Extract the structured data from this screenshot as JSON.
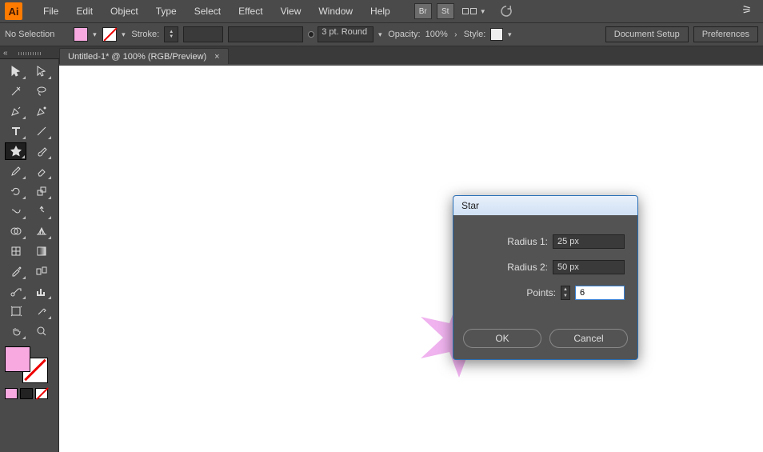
{
  "app": {
    "logo": "Ai"
  },
  "menu": {
    "items": [
      "File",
      "Edit",
      "Object",
      "Type",
      "Select",
      "Effect",
      "View",
      "Window",
      "Help"
    ],
    "br": "Br",
    "st": "St"
  },
  "control": {
    "selection": "No Selection",
    "stroke_label": "Stroke:",
    "stroke_weight": "3 pt. Round",
    "opacity_label": "Opacity:",
    "opacity_value": "100%",
    "style_label": "Style:",
    "doc_setup": "Document Setup",
    "preferences": "Preferences"
  },
  "tab": {
    "title": "Untitled-1* @ 100% (RGB/Preview)"
  },
  "dialog": {
    "title": "Star",
    "radius1_label": "Radius 1:",
    "radius1_value": "25 px",
    "radius2_label": "Radius 2:",
    "radius2_value": "50 px",
    "points_label": "Points:",
    "points_value": "6",
    "ok": "OK",
    "cancel": "Cancel"
  },
  "colors": {
    "fill": "#f7a9e0"
  }
}
